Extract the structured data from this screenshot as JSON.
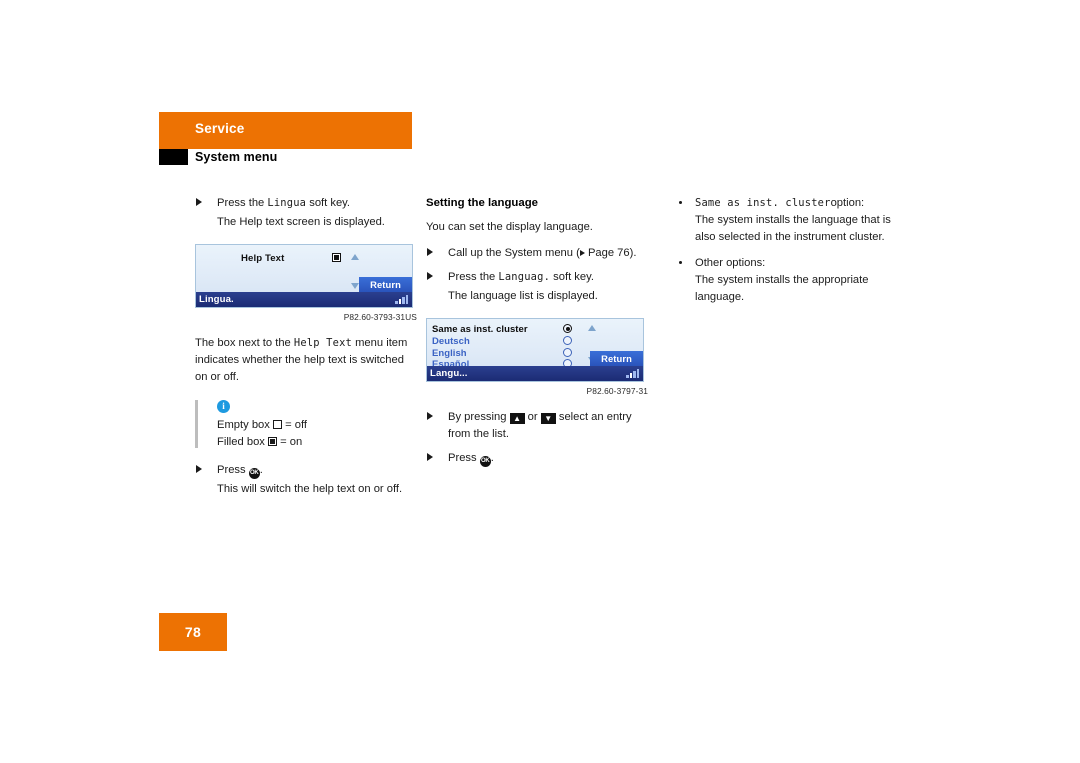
{
  "header": {
    "chapter": "Service",
    "section": "System menu"
  },
  "footer": {
    "page_number": "78"
  },
  "colors": {
    "accent_orange": "#ed7203",
    "screen_blue_bar": "#2b3f8f",
    "return_key_blue": "#3a6fd8",
    "info_icon_blue": "#1e9ae0",
    "list_option_blue": "#3b63c4"
  },
  "col1": {
    "step1": {
      "pre": "Press the",
      "mono": "Lingua",
      "post": "soft key."
    },
    "step1_result": "The Help text screen is displayed.",
    "screenshot1": {
      "title": "Help Text",
      "status_label": "Lingua.",
      "return_label": "Return",
      "caption": "P82.60-3793-31US"
    },
    "para1_pre": "The box next to the",
    "para1_mono": "Help Text",
    "para1_post": "menu item indicates whether the help text is switched on or off.",
    "note": {
      "icon": "info-icon",
      "line1_pre": "Empty box",
      "line1_post": "= off",
      "line2_pre": "Filled box",
      "line2_post": "= on"
    },
    "step2": {
      "pre": "Press",
      "key": "OK",
      "post": "."
    },
    "step2_result": "This will switch the help text on or off."
  },
  "col2": {
    "heading": "Setting the language",
    "intro": "You can set the display language.",
    "step1": "Call up the System menu (",
    "step1_page": "Page 76).",
    "step2": {
      "pre": "Press the",
      "mono": "Languag.",
      "post": "soft key."
    },
    "step2_result": "The language list is displayed.",
    "screenshot2": {
      "items": [
        "Same as inst. cluster",
        "Deutsch",
        "English",
        "Español"
      ],
      "selected_index": 0,
      "status_label": "Langu...",
      "return_label": "Return",
      "caption": "P82.60-3797-31"
    },
    "step3": {
      "pre": "By pressing",
      "mid": "or",
      "post": "select an entry from the list."
    },
    "step4": {
      "pre": "Press",
      "key": "OK",
      "post": "."
    }
  },
  "col3": {
    "bullet1": {
      "mono": "Same as inst. cluster",
      "label": "option:",
      "body": "The system installs the language that is also selected in the instrument cluster."
    },
    "bullet2": {
      "label": "Other options:",
      "body": "The system installs the appropriate language."
    }
  }
}
